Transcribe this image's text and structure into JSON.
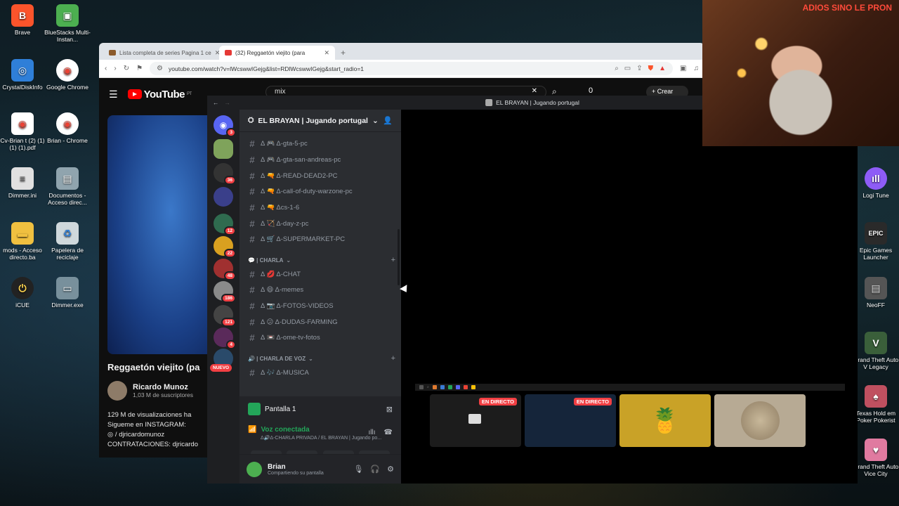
{
  "desktop": {
    "left_icons": [
      {
        "label": "Brave",
        "glyph": "B",
        "color": "#fb542b"
      },
      {
        "label": "BlueStacks Multi-Instan...",
        "glyph": "▣",
        "color": "#4caf50"
      },
      {
        "label": "CrystalDiskInfo",
        "glyph": "◎",
        "color": "#2f7fd8"
      },
      {
        "label": "Google Chrome",
        "glyph": "◉",
        "color": "#ea4335"
      },
      {
        "label": "Cv-Brian t (2) (1) (1) (1).pdf",
        "glyph": "◉",
        "color": "#ea4335"
      },
      {
        "label": "Brian - Chrome",
        "glyph": "◉",
        "color": "#ea4335"
      },
      {
        "label": "Dimmer.ini",
        "glyph": "≡",
        "color": "#e0e0e0"
      },
      {
        "label": "Documentos - Acceso direc...",
        "glyph": "▤",
        "color": "#90a4ae"
      },
      {
        "label": "mods - Acceso directo.ba",
        "glyph": "▬",
        "color": "#f0c040"
      },
      {
        "label": "Papelera de reciclaje",
        "glyph": "♻",
        "color": "#b0bec5"
      },
      {
        "label": "iCUE",
        "glyph": "⏻",
        "color": "#222222"
      },
      {
        "label": "Dimmer.exe",
        "glyph": "▭",
        "color": "#78909c"
      }
    ],
    "right_icons": [
      {
        "label": "Logi Tune",
        "glyph": "ıll",
        "color": "#8e5cf7"
      },
      {
        "label": "Epic Games Launcher",
        "glyph": "EPIC",
        "color": "#2a2a2a"
      },
      {
        "label": "NeoFF",
        "glyph": "▤",
        "color": "#555555"
      },
      {
        "label": "Grand Theft Auto V Legacy",
        "glyph": "V",
        "color": "#3a5f3a"
      },
      {
        "label": "Texas Hold em Poker Pokerist",
        "glyph": "♠",
        "color": "#c05060"
      },
      {
        "label": "Grand Theft Auto Vice City",
        "glyph": "♥",
        "color": "#e07aa0"
      }
    ]
  },
  "browser": {
    "tabs": [
      {
        "title": "Lista completa de series Pagina 1 ce",
        "active": false,
        "type": "series"
      },
      {
        "title": "(32) Reggaetón viejito (para",
        "active": true,
        "type": "youtube"
      }
    ],
    "url": "youtube.com/watch?v=lWcswwIGejg&list=RDlWcswwIGejg&start_radio=1",
    "youtube": {
      "region": "PT",
      "search_value": "mix",
      "create_label": "+ Crear",
      "notif_count": "0",
      "video_title": "Reggaetón viejito (pa",
      "channel_name": "Ricardo Munoz",
      "subscribers": "1,03 M de suscriptores",
      "desc_lines": [
        "129 M de visualizaciones  ha",
        "Sigueme en INSTAGRAM:",
        "◎ / djricardomunoz",
        "CONTRATACIONES: djricardo"
      ]
    }
  },
  "discord": {
    "window_title": "EL BRAYAN | Jugando portugal",
    "server_name": "EL BRAYAN | Jugando portugal",
    "nuevo": "NUEVO",
    "guild_badges": [
      "3",
      "",
      "36",
      "",
      "12",
      "22",
      "48",
      "186",
      "121",
      "4"
    ],
    "channels_top": [
      "Δ 🎮 Δ-gta-5-pc",
      "Δ 🎮 Δ-gta-san-andreas-pc",
      "Δ 🔫 Δ-READ-DEAD2-PC",
      "Δ 🔫 Δ-call-of-duty-warzone-pc",
      "Δ 🔫 Δcs-1-6",
      "Δ 🏹 Δ-day-z-pc",
      "Δ 🛒 Δ-SUPERMARKET-PC"
    ],
    "category_charla": "💬 | CHARLA",
    "channels_charla": [
      "Δ 💋 Δ-CHAT",
      "Δ 😄 Δ-memes",
      "Δ 📷 Δ-FOTOS-VIDEOS",
      "Δ 😕 Δ-DUDAS-FARMING",
      "Δ 📼 Δ-ome-tv-fotos"
    ],
    "category_voz": "🔊 | CHARLA DE VOZ",
    "channels_voz": [
      "Δ 🎶 Δ-MUSICA"
    ],
    "stream_label": "Pantalla 1",
    "voice_status": "Voz conectada",
    "voice_channel": "Δ🔊Δ-CHARLA PRIVADA / EL BRAYAN | Jugando po...",
    "user_name": "Brian",
    "user_status": "Compartiendo su pantalla",
    "live_label": "EN DIRECTO"
  },
  "webcam": {
    "sign_text": "ADIOS SINO LE PRON"
  }
}
